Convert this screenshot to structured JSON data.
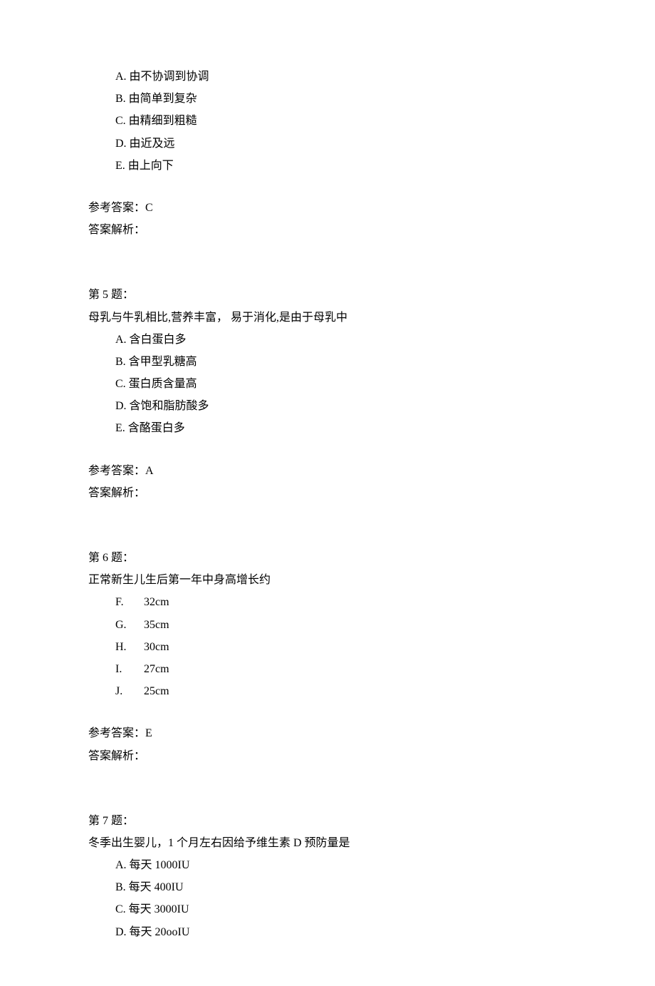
{
  "q4": {
    "options": {
      "A": "A. 由不协调到协调",
      "B": "B. 由简单到复杂",
      "C": "C. 由精细到粗糙",
      "D": "D. 由近及远",
      "E": "E. 由上向下"
    },
    "answer_label": "参考答案：C",
    "analysis_label": "答案解析："
  },
  "q5": {
    "header": "第 5 题：",
    "stem": "母乳与牛乳相比,营养丰富， 易于消化,是由于母乳中",
    "options": {
      "A": "A. 含白蛋白多",
      "B": "B. 含甲型乳糖高",
      "C": "C. 蛋白质含量高",
      "D": "D. 含饱和脂肪酸多",
      "E": "E. 含酪蛋白多"
    },
    "answer_label": "参考答案：A",
    "analysis_label": "答案解析："
  },
  "q6": {
    "header": "第 6 题：",
    "stem": "正常新生儿生后第一年中身高增长约",
    "options": {
      "F": {
        "letter": "F.",
        "value": "32cm"
      },
      "G": {
        "letter": "G.",
        "value": "35cm"
      },
      "H": {
        "letter": "H.",
        "value": "30cm"
      },
      "I": {
        "letter": "I.",
        "value": "27cm"
      },
      "J": {
        "letter": "J.",
        "value": "25cm"
      }
    },
    "answer_label": "参考答案：E",
    "analysis_label": "答案解析："
  },
  "q7": {
    "header": "第 7 题：",
    "stem": "冬季出生婴儿，1 个月左右因给予维生素 D 预防量是",
    "options": {
      "A": "A. 每天 1000IU",
      "B": "B. 每天 400IU",
      "C": "C. 每天 3000IU",
      "D": "D. 每天 20ooIU"
    }
  }
}
